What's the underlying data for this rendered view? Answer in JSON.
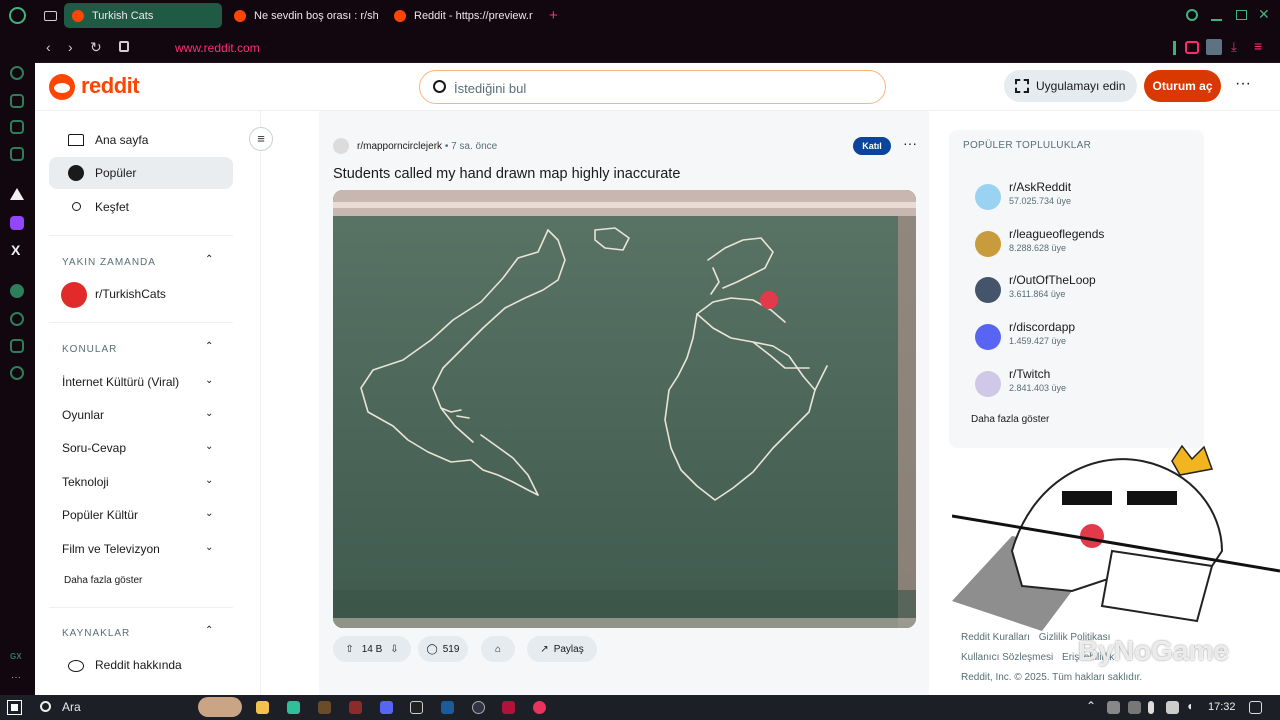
{
  "browser": {
    "tabs": [
      {
        "title": "Turkish Cats",
        "active": true
      },
      {
        "title": "Ne sevdin boş orası : r/sh",
        "active": false
      },
      {
        "title": "Reddit - https://preview.r",
        "active": false
      }
    ],
    "new_tab": "+",
    "url": "www.reddit.com"
  },
  "header": {
    "logo": "reddit",
    "search_placeholder": "İstediğini bul",
    "get_app": "Uygulamayı edin",
    "login": "Oturum aç",
    "more": "···"
  },
  "sidebar": {
    "nav": [
      {
        "label": "Ana sayfa",
        "icon": "home-icon"
      },
      {
        "label": "Popüler",
        "icon": "popular-icon",
        "active": true
      },
      {
        "label": "Keşfet",
        "icon": "explore-icon"
      }
    ],
    "recent_heading": "YAKIN ZAMANDA",
    "recent": [
      {
        "label": "r/TurkishCats"
      }
    ],
    "topics_heading": "KONULAR",
    "topics": [
      "İnternet Kültürü (Viral)",
      "Oyunlar",
      "Soru-Cevap",
      "Teknoloji",
      "Popüler Kültür",
      "Film ve Televizyon"
    ],
    "show_more": "Daha fazla göster",
    "resources_heading": "KAYNAKLAR",
    "resources": [
      {
        "label": "Reddit hakkında"
      }
    ]
  },
  "post": {
    "subreddit": "r/mapporncirclejerk",
    "time": "7 sa. önce",
    "join": "Katıl",
    "title": "Students called my hand drawn map highly inaccurate",
    "votes": "14 B",
    "comments": "519",
    "share": "Paylaş"
  },
  "popular": {
    "heading": "POPÜLER TOPLULUKLAR",
    "communities": [
      {
        "name": "r/AskReddit",
        "members": "57.025.734 üye",
        "color": "#9ad2f2"
      },
      {
        "name": "r/leagueoflegends",
        "members": "8.288.628 üye",
        "color": "#c89b3c"
      },
      {
        "name": "r/OutOfTheLoop",
        "members": "3.611.864 üye",
        "color": "#44556b"
      },
      {
        "name": "r/discordapp",
        "members": "1.459.427 üye",
        "color": "#5865f2"
      },
      {
        "name": "r/Twitch",
        "members": "2.841.403 üye",
        "color": "#cfc8e6"
      }
    ],
    "show_more": "Daha fazla göster"
  },
  "footer": {
    "links": [
      "Reddit Kuralları",
      "Gizlilik Politikası",
      "Kullanıcı Sözleşmesi",
      "Erişilebilirlik"
    ],
    "copyright": "Reddit, Inc. © 2025. Tüm hakları saklıdır."
  },
  "watermark": "ByNoGame",
  "taskbar": {
    "search": "Ara",
    "time": "17:32"
  },
  "colors": {
    "accent": "#ff4500",
    "login": "#d93900",
    "join": "#0a449b",
    "chalkboard": "#4d665a"
  }
}
